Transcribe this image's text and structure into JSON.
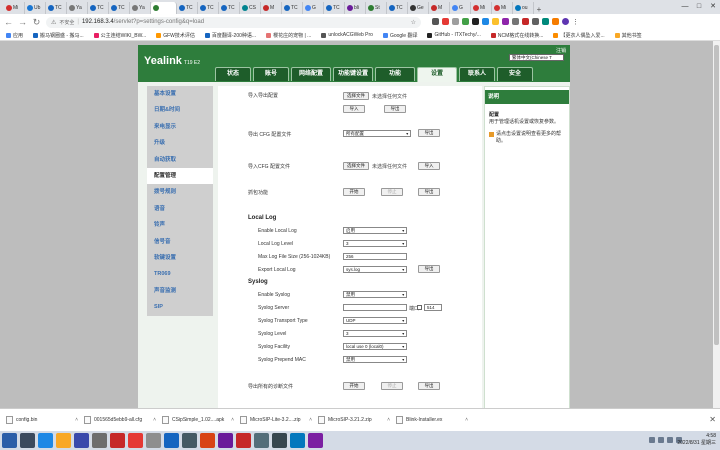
{
  "browser": {
    "tabs": [
      {
        "label": "Mi",
        "color": "#d32f2f"
      },
      {
        "label": "Ub",
        "color": "#1976d2"
      },
      {
        "label": "TC",
        "color": "#1565c0"
      },
      {
        "label": "Ya",
        "color": "#777777"
      },
      {
        "label": "TC",
        "color": "#1565c0"
      },
      {
        "label": "TC",
        "color": "#1565c0"
      },
      {
        "label": "Ya",
        "color": "#777777"
      },
      {
        "label": "",
        "color": "#2e7d32",
        "active": true
      },
      {
        "label": "TC",
        "color": "#1565c0"
      },
      {
        "label": "TC",
        "color": "#1565c0"
      },
      {
        "label": "TC",
        "color": "#1565c0"
      },
      {
        "label": "CS",
        "color": "#00838f"
      },
      {
        "label": "M",
        "color": "#c62828"
      },
      {
        "label": "TC",
        "color": "#1565c0"
      },
      {
        "label": "G",
        "color": "#4285f4"
      },
      {
        "label": "TC",
        "color": "#1565c0"
      },
      {
        "label": "bli",
        "color": "#6a1b9a"
      },
      {
        "label": "St",
        "color": "#2e7d32"
      },
      {
        "label": "TC",
        "color": "#1565c0"
      },
      {
        "label": "Ge",
        "color": "#333333"
      },
      {
        "label": "M",
        "color": "#c62828"
      },
      {
        "label": "G",
        "color": "#4285f4"
      },
      {
        "label": "Mi",
        "color": "#d32f2f"
      },
      {
        "label": "Mi",
        "color": "#d32f2f"
      },
      {
        "label": "ou",
        "color": "#0277bd"
      }
    ],
    "url": {
      "security": "不安全",
      "host": "192.168.3.4",
      "path": "/servlet?p=settings-config&q=load"
    },
    "bookmarks": [
      {
        "label": "应用",
        "color": "#4285f4"
      },
      {
        "label": "搬马钢圈盛 - 搬马...",
        "color": "#1565c0"
      },
      {
        "label": "公主连结WIKI_BW...",
        "color": "#e91e63"
      },
      {
        "label": "GFW技术评估",
        "color": "#ff9800"
      },
      {
        "label": "百度翻译-200种语...",
        "color": "#1565c0"
      },
      {
        "label": "樱花庄的宠物 | ...",
        "color": "#e57373"
      },
      {
        "label": "unlockACGWeb Pro",
        "color": "#555555"
      },
      {
        "label": "Google 翻译",
        "color": "#4285f4"
      },
      {
        "label": "GitHub - ITXTechy/...",
        "color": "#222222"
      },
      {
        "label": "NCM格式在线转换...",
        "color": "#c62828"
      },
      {
        "label": "【更衣人偶坠入爱...",
        "color": "#fb8c00"
      },
      {
        "label": "其他书签",
        "color": "#f9a825"
      }
    ]
  },
  "header": {
    "logo": "Yealink",
    "model": "T19 E2",
    "logout": "注销",
    "language": "繁体中文(Chinese T",
    "tabs": [
      "状态",
      "账号",
      "网络配置",
      "功能键设置",
      "功能",
      "设置",
      "联系人",
      "安全"
    ],
    "active_tab": 5
  },
  "sidenav": [
    "基本设置",
    "日期&时间",
    "来电显示",
    "升级",
    "自动获取",
    "配置管理",
    "拨号规则",
    "语音",
    "铃声",
    "信号音",
    "软键设置",
    "TR069",
    "声音监测",
    "SIP"
  ],
  "sidenav_active": 5,
  "form": {
    "import_export_label": "导入导出配置",
    "choose_file": "选择文件",
    "no_file": "未选择任何文件",
    "import": "导入",
    "export": "导出",
    "export_cfg_label": "导出 CFG 配置文件",
    "export_cfg_value": "所有配置",
    "import_cfg_label": "导入CFG 配置文件",
    "capture_label": "抓包功能",
    "start": "开始",
    "stop": "停止",
    "local_log": "Local Log",
    "enable_local_log": "Enable Local Log",
    "enable_local_log_value": "启用",
    "local_log_level": "Local Log Level",
    "local_log_level_value": "3",
    "max_log_size": "Max Log File Size (256-1024KB)",
    "max_log_size_value": "256",
    "export_local_log": "Export Local Log",
    "export_local_log_value": "sys.log",
    "syslog": "Syslog",
    "enable_syslog": "Enable Syslog",
    "enable_syslog_value": "禁用",
    "syslog_server": "Syslog Server",
    "port_label": "端口",
    "port_value": "514",
    "syslog_transport": "Syslog Transport Type",
    "syslog_transport_value": "UDP",
    "syslog_level": "Syslog Level",
    "syslog_level_value": "3",
    "syslog_facility": "Syslog Facility",
    "syslog_facility_value": "local use 0 (local0)",
    "syslog_prepend_mac": "Syslog Prepend MAC",
    "syslog_prepend_mac_value": "禁用",
    "export_diag_label": "导出所有的诊断文件"
  },
  "help": {
    "title": "说明",
    "heading": "配置",
    "text": "用于管理话机设置或恢复参数。",
    "note": "请点击设置说明查看更多的帮助。"
  },
  "downloads": [
    {
      "name": "config.bin"
    },
    {
      "name": "001565d5ebb9-all.cfg"
    },
    {
      "name": "CSipSimple_1.02....apk"
    },
    {
      "name": "MicroSIP-Lite-3.2....zip"
    },
    {
      "name": "MicroSIP-3.21.2.zip"
    },
    {
      "name": "Blink-Installer.ex"
    }
  ],
  "taskbar": {
    "icons": [
      "#2b5ea8",
      "#3b4a5e",
      "#1e88e5",
      "#f9a825",
      "#3949ab",
      "#6d6d6d",
      "#c62828",
      "#e53935",
      "#8e8e8e",
      "#1565c0",
      "#455a64",
      "#d84315",
      "#6a1b9a",
      "#c62828",
      "#546e7a",
      "#37474f",
      "#0277bd",
      "#7b1fa2"
    ],
    "time": "4:58",
    "date": "2022/8/31 星期三"
  }
}
